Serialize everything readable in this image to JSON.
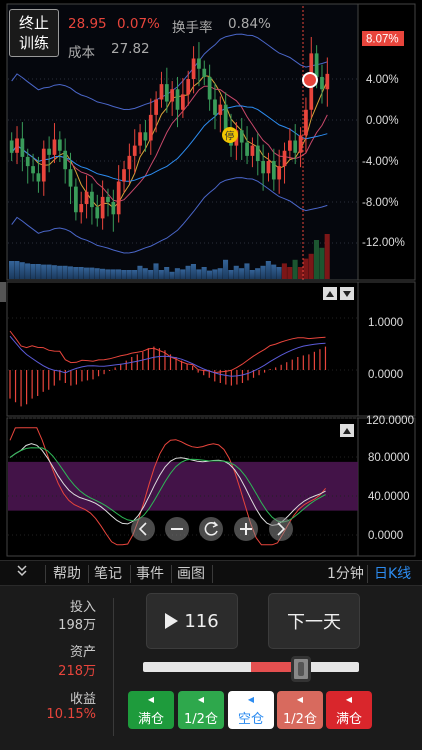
{
  "header": {
    "stop_button": [
      "终止",
      "训练"
    ],
    "price": "28.95",
    "change_pct": "0.07%",
    "turnover_label": "换手率",
    "turnover_value": "0.84%",
    "cost_label": "成本",
    "cost_value": "27.82",
    "current_change_tag": "8.07%",
    "halt_marker": "停"
  },
  "colors": {
    "up": "#e8453c",
    "down": "#3a9c5a",
    "accent_blue": "#2d8cf0",
    "green_btn": "#1e9b3c",
    "red_btn": "#d9262c",
    "light_red_btn": "#d86a5e",
    "bg": "#000000",
    "panel_bg": "#1b1b1b"
  },
  "main_axis": {
    "labels": [
      "4.00%",
      "0.00%",
      "-4.00%",
      "-8.00%",
      "-12.00%"
    ]
  },
  "chart_data": [
    {
      "type": "candlestick",
      "ylabel": "",
      "ylim": [
        -15,
        11
      ],
      "y_ticks": [
        4,
        0,
        -4,
        -8,
        -12
      ],
      "x_count": 60,
      "open": [
        -2.0,
        -3.2,
        -1.8,
        -3.6,
        -4.5,
        -5.2,
        -6.0,
        -2.8,
        -3.4,
        -1.9,
        -3.0,
        -4.8,
        -6.5,
        -9.0,
        -8.2,
        -7.0,
        -8.5,
        -9.6,
        -7.5,
        -8.0,
        -9.2,
        -6.0,
        -4.8,
        -3.5,
        -2.5,
        -1.2,
        -2.0,
        0.5,
        2.0,
        3.5,
        1.8,
        3.0,
        1.0,
        2.5,
        4.0,
        6.0,
        5.0,
        4.2,
        2.0,
        0.5,
        1.5,
        -1.0,
        -2.5,
        -1.0,
        -2.2,
        -3.5,
        -2.5,
        -4.0,
        -5.2,
        -4.0,
        -5.8,
        -4.5,
        -3.0,
        -2.0,
        -3.2,
        -1.5,
        1.0,
        6.5,
        4.2,
        3.0
      ],
      "close": [
        -3.2,
        -1.8,
        -3.6,
        -4.5,
        -5.2,
        -6.0,
        -2.8,
        -3.4,
        -1.9,
        -3.0,
        -4.8,
        -6.5,
        -9.0,
        -8.2,
        -7.0,
        -8.5,
        -9.6,
        -7.5,
        -8.0,
        -9.2,
        -6.0,
        -4.8,
        -3.5,
        -2.5,
        -1.2,
        -2.0,
        0.5,
        2.0,
        3.5,
        1.8,
        3.0,
        1.0,
        2.5,
        4.0,
        6.0,
        5.0,
        4.2,
        2.0,
        0.5,
        1.5,
        -1.0,
        -2.5,
        -1.0,
        -2.2,
        -3.5,
        -2.5,
        -4.0,
        -5.2,
        -4.0,
        -5.8,
        -4.5,
        -3.0,
        -2.0,
        -3.2,
        -1.5,
        1.0,
        6.5,
        4.2,
        3.0,
        4.5
      ],
      "volume": [
        3,
        3,
        2.8,
        2.6,
        2.5,
        2.5,
        2.4,
        2.4,
        2.3,
        2.2,
        2.2,
        2.1,
        2.0,
        2.0,
        1.9,
        1.9,
        1.8,
        1.7,
        1.6,
        1.6,
        1.6,
        1.5,
        1.5,
        1.5,
        2.2,
        1.8,
        1.5,
        2.6,
        1.5,
        2.0,
        1.2,
        1.8,
        1.6,
        2.2,
        2.5,
        1.6,
        2.0,
        1.4,
        1.6,
        1.8,
        3.2,
        1.5,
        2.2,
        1.8,
        2.6,
        1.5,
        1.8,
        2.2,
        3.0,
        2.4,
        2.0,
        2.6,
        2.0,
        3.2,
        2.0,
        3.4,
        4.2,
        6.5,
        5.2,
        7.5
      ]
    },
    {
      "type": "bar",
      "ylabel": "",
      "ylim": [
        -0.8,
        1.7
      ],
      "y_ticks": [
        1.0,
        0.0
      ],
      "y_tick_labels": [
        "1.0000",
        "0.0000"
      ],
      "values": [
        -0.55,
        -0.62,
        -0.7,
        -0.66,
        -0.55,
        -0.5,
        -0.42,
        -0.38,
        -0.3,
        -0.2,
        -0.25,
        -0.3,
        -0.28,
        -0.22,
        -0.2,
        -0.18,
        -0.12,
        -0.08,
        -0.02,
        0.05,
        0.12,
        0.18,
        0.25,
        0.3,
        0.35,
        0.42,
        0.45,
        0.42,
        0.38,
        0.3,
        0.25,
        0.18,
        0.12,
        0.08,
        -0.05,
        -0.1,
        -0.15,
        -0.22,
        -0.25,
        -0.28,
        -0.3,
        -0.28,
        -0.25,
        -0.2,
        -0.15,
        -0.1,
        -0.05,
        0.02,
        0.05,
        0.1,
        0.15,
        0.2,
        0.25,
        0.28,
        0.3,
        0.35,
        0.4,
        0.45
      ]
    },
    {
      "type": "line",
      "ylabel": "",
      "ylim": [
        -20,
        120
      ],
      "y_ticks": [
        120,
        80,
        40,
        0
      ],
      "y_tick_labels": [
        "120.0000",
        "80.0000",
        "40.0000",
        "0.0000"
      ],
      "band": [
        25,
        75
      ]
    }
  ],
  "zoom_controls": [
    "chevron-left-icon",
    "zoom-out-icon",
    "reset-icon",
    "zoom-in-icon",
    "chevron-right-icon"
  ],
  "tabs": {
    "collapse_icon": "double-chevron-down-icon",
    "help": "帮助",
    "notes": "笔记",
    "events": "事件",
    "draw": "画图",
    "one_min": "1分钟",
    "daily_k": "日K线"
  },
  "stats": {
    "invest_label": "投入",
    "invest_value": "198万",
    "assets_label": "资产",
    "assets_value": "218万",
    "profit_label": "收益",
    "profit_value": "10.15%"
  },
  "controls": {
    "play_count": "116",
    "next_day": "下一天",
    "slider_value": 0.73,
    "slider_fill_start": 0.5
  },
  "position_buttons": [
    {
      "label": "满仓",
      "bg": "#1e9b3c",
      "color": "#ffffff"
    },
    {
      "label": "1/2仓",
      "bg": "#2ea84c",
      "color": "#ffffff"
    },
    {
      "label": "空仓",
      "bg": "#ffffff",
      "color": "#2d8cf0"
    },
    {
      "label": "1/2仓",
      "bg": "#d86a5e",
      "color": "#ffffff"
    },
    {
      "label": "满仓",
      "bg": "#d9262c",
      "color": "#ffffff"
    }
  ]
}
